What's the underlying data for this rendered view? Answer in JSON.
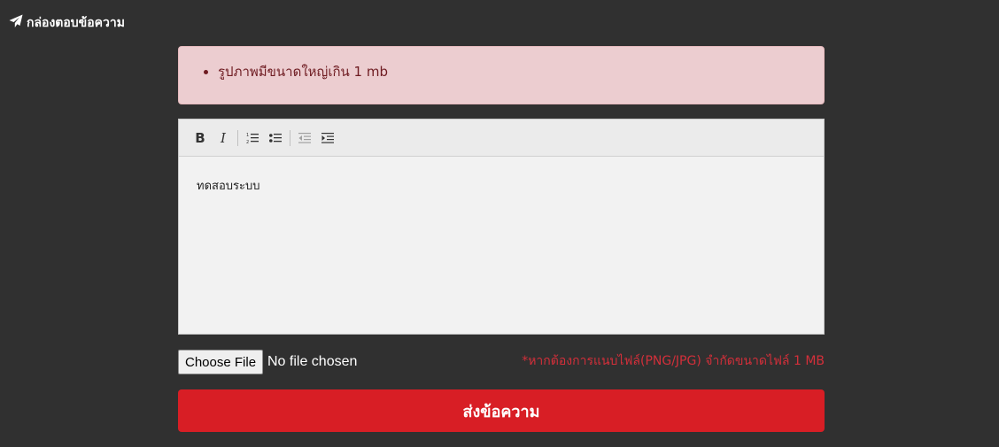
{
  "header": {
    "title": "กล่องตอบข้อความ",
    "icon": "paper-plane-icon"
  },
  "alert": {
    "items": [
      "รูปภาพมีขนาดใหญ่เกิน 1 mb"
    ]
  },
  "editor": {
    "toolbar": [
      {
        "name": "bold",
        "label": "B"
      },
      {
        "name": "italic",
        "label": "I"
      },
      {
        "name": "ordered-list-icon"
      },
      {
        "name": "bullet-list-icon"
      },
      {
        "name": "outdent-icon"
      },
      {
        "name": "indent-icon"
      }
    ],
    "content": "ทดสอบระบบ"
  },
  "file": {
    "button_label": "Choose File",
    "status": "No file chosen",
    "note": "*หากต้องการแนบไฟล์(PNG/JPG) จำกัดขนาดไฟล์ 1 MB"
  },
  "submit": {
    "label": "ส่งข้อความ"
  },
  "colors": {
    "background": "#303030",
    "alert_bg": "#eccdd0",
    "alert_text": "#6e1b21",
    "accent": "#d81e25",
    "note": "#d32f3a"
  }
}
